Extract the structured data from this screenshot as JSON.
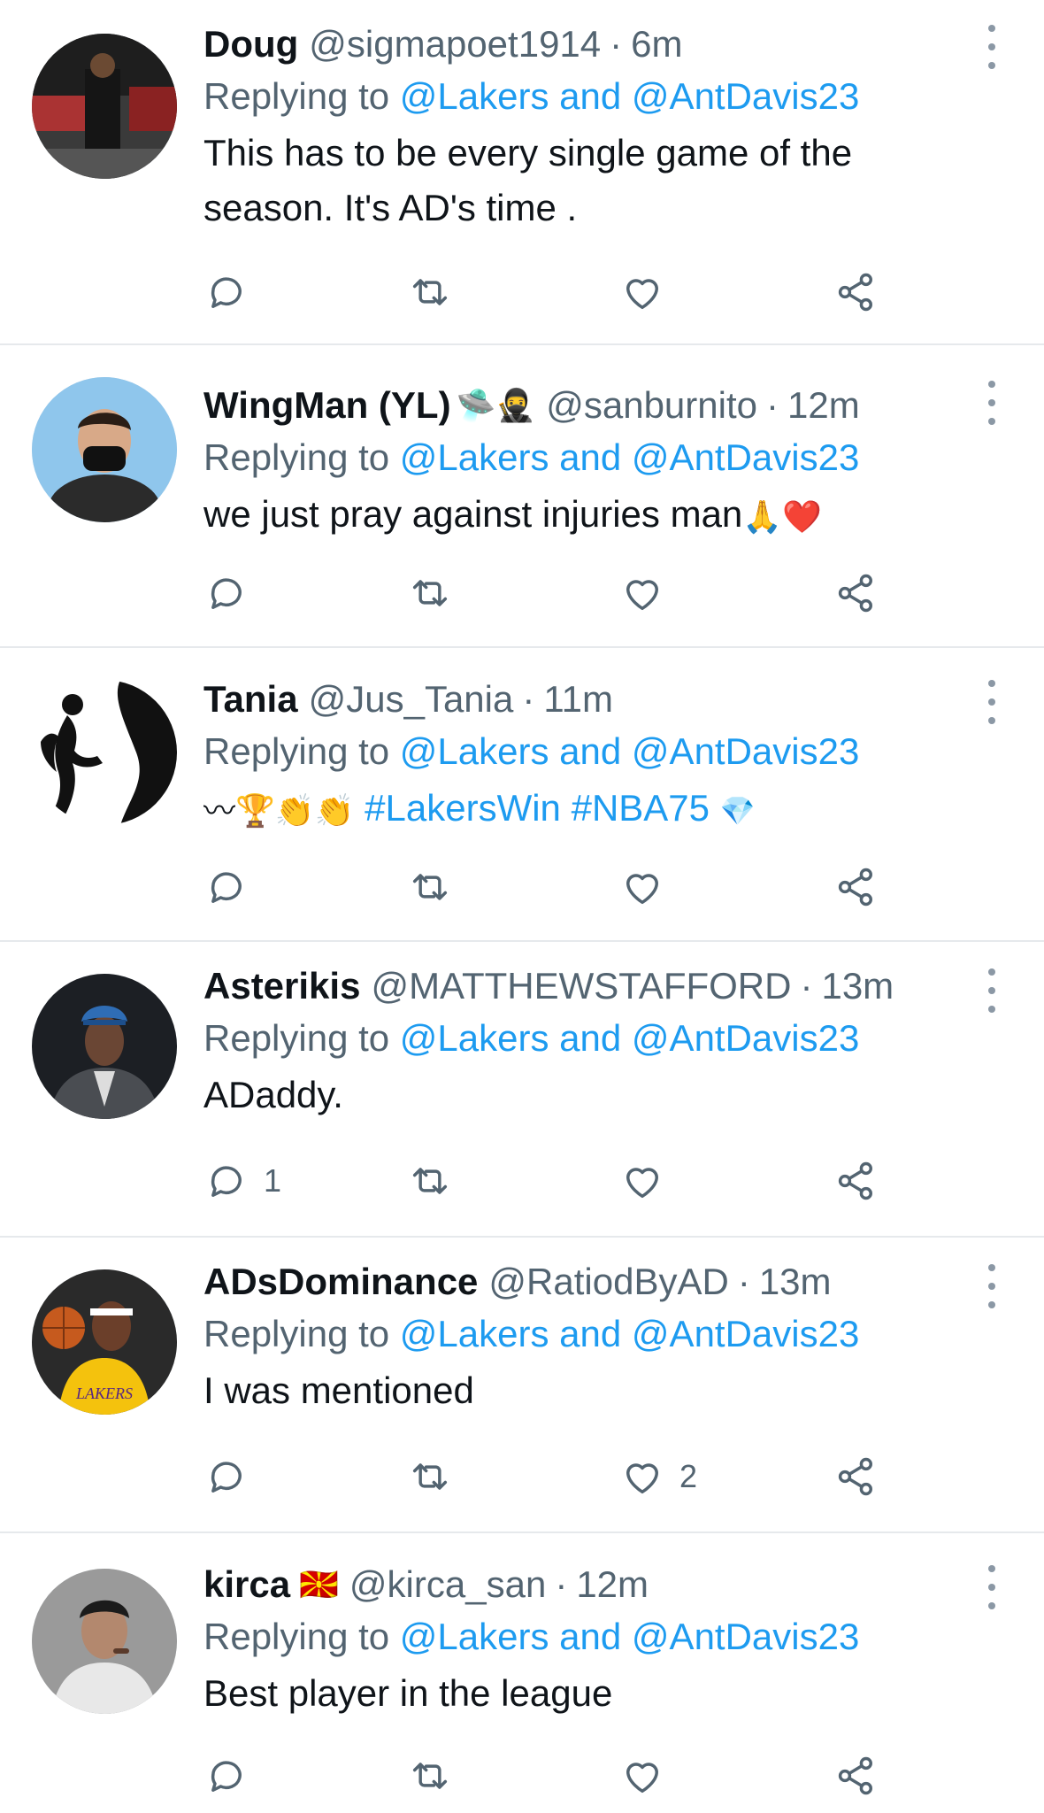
{
  "colors": {
    "accent": "#1d9bf0",
    "secondary_text": "#536471",
    "primary_text": "#0f1419",
    "divider": "#e6e9ec",
    "heart": "#e0245e"
  },
  "tweets": [
    {
      "name": "Doug",
      "handle": "@sigmapoet1914",
      "separator": "·",
      "time": "6m",
      "replying_prefix": "Replying to ",
      "replying_1": "@Lakers",
      "replying_and": " and ",
      "replying_2": "@AntDavis23",
      "text": "This has to be every single game of the season. It's AD's time .",
      "reply_count": "",
      "retweet_count": "",
      "like_count": ""
    },
    {
      "name": "WingMan (YL)",
      "name_emojis": "🛸🥷",
      "handle": "@sanburnito",
      "separator": "·",
      "time": "12m",
      "replying_prefix": "Replying to ",
      "replying_1": "@Lakers",
      "replying_and": " and ",
      "replying_2": "@AntDavis23",
      "text": "we just pray against injuries man",
      "text_emojis": "🙏❤️",
      "reply_count": "",
      "retweet_count": "",
      "like_count": ""
    },
    {
      "name": "Tania",
      "handle": "@Jus_Tania",
      "separator": "·",
      "time": "11m",
      "replying_prefix": "Replying to ",
      "replying_1": "@Lakers",
      "replying_and": " and ",
      "replying_2": "@AntDavis23",
      "text_emojis": "〰🏆👏👏",
      "hashtag_1": "#LakersWin",
      "hashtag_2": "#NBA75",
      "hashtag_emoji": "💎",
      "reply_count": "",
      "retweet_count": "",
      "like_count": ""
    },
    {
      "name": "Asterikis",
      "handle": "@MATTHEWSTAFFORD",
      "separator": "·",
      "time": "13m",
      "replying_prefix": "Replying to ",
      "replying_1": "@Lakers",
      "replying_and": " and ",
      "replying_2": "@AntDavis23",
      "text": "ADaddy.",
      "reply_count": "1",
      "retweet_count": "",
      "like_count": ""
    },
    {
      "name": "ADsDominance",
      "handle": "@RatiodByAD",
      "separator": "·",
      "time": "13m",
      "replying_prefix": "Replying to ",
      "replying_1": "@Lakers",
      "replying_and": " and ",
      "replying_2": "@AntDavis23",
      "text": "I was mentioned",
      "reply_count": "",
      "retweet_count": "",
      "like_count": "2"
    },
    {
      "name": "kirca",
      "name_emojis": "🇲🇰",
      "handle": "@kirca_san",
      "separator": "·",
      "time": "12m",
      "replying_prefix": "Replying to ",
      "replying_1": "@Lakers",
      "replying_and": " and ",
      "replying_2": "@AntDavis23",
      "text": "Best player in the league",
      "reply_count": "",
      "retweet_count": "",
      "like_count": ""
    }
  ],
  "icons": {
    "reply": "reply-icon",
    "retweet": "retweet-icon",
    "like": "heart-icon",
    "share": "share-icon",
    "more": "more-vertical-icon"
  }
}
